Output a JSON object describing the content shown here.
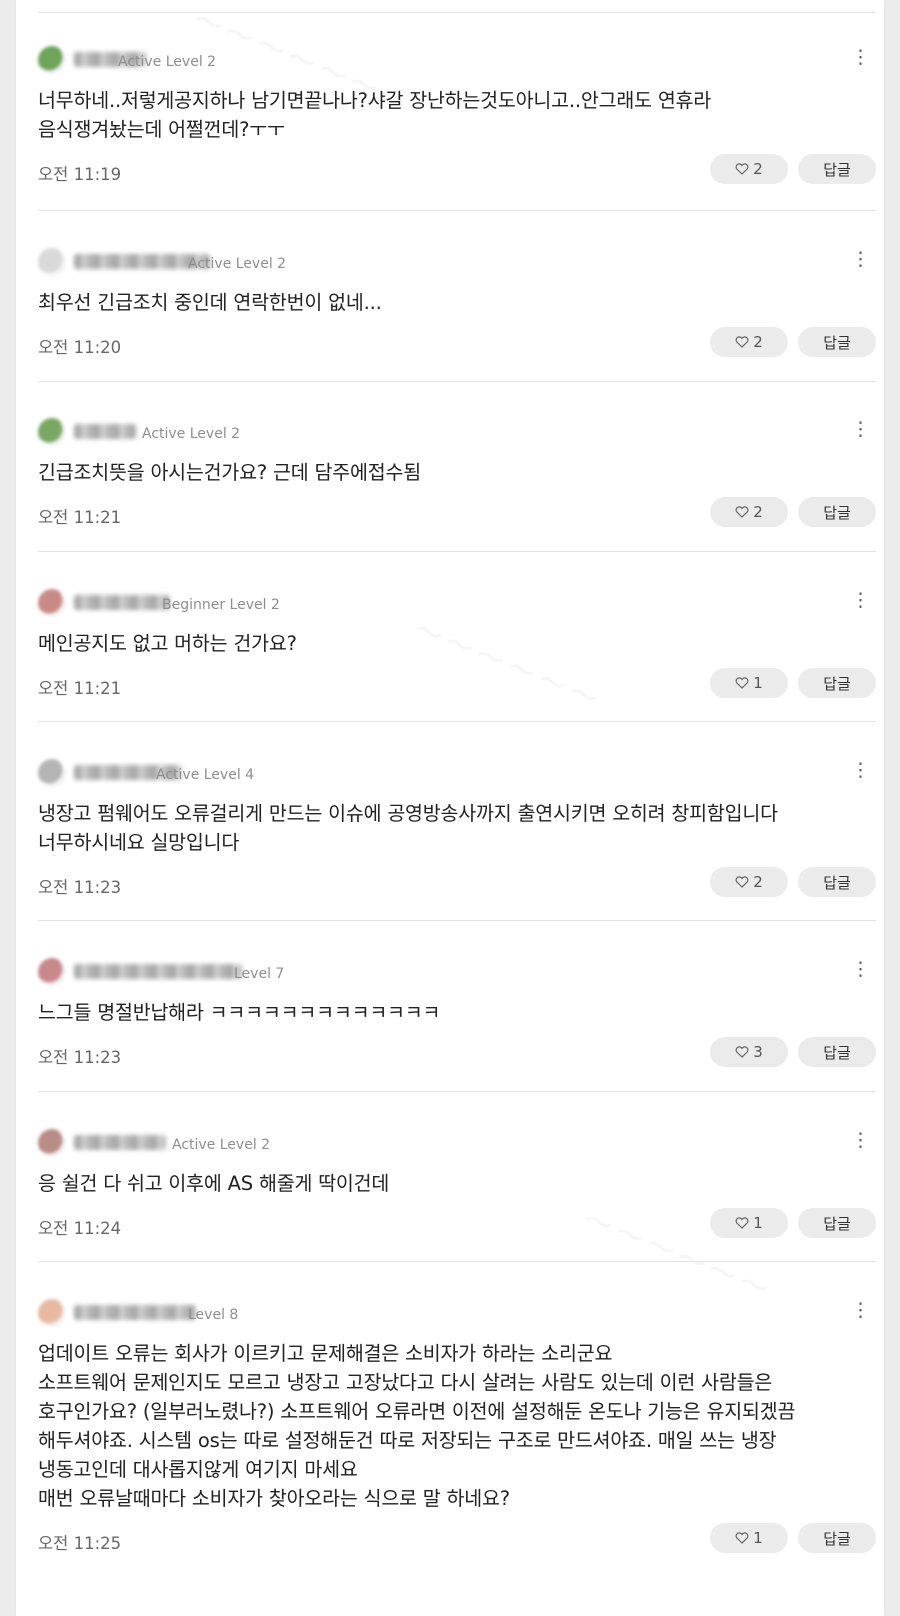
{
  "comments": [
    {
      "level": "Active Level 2",
      "text": "너무하네..저렇게공지하나 남기면끝나나?샤갈 장난하는것도아니고..안그래도 연휴라\n음식쟁겨놨는데 어쩔껀데?ㅜㅜ",
      "time": "오전 11:19",
      "likes": "2",
      "reply": "답글",
      "avatar_color": "#6ea55a"
    },
    {
      "level": "Active Level 2",
      "text": "최우선 긴급조치 중인데 연락한번이 없네...",
      "time": "오전 11:20",
      "likes": "2",
      "reply": "답글",
      "avatar_color": "#d9d9d9"
    },
    {
      "level": "Active Level 2",
      "text": "긴급조치뜻을 아시는건가요? 근데 담주에접수됨",
      "time": "오전 11:21",
      "likes": "2",
      "reply": "답글",
      "avatar_color": "#79a862"
    },
    {
      "level": "Beginner Level 2",
      "text": "메인공지도 없고 머하는 건가요?",
      "time": "오전 11:21",
      "likes": "1",
      "reply": "답글",
      "avatar_color": "#c98a86"
    },
    {
      "level": "Active Level 4",
      "text": "냉장고 펌웨어도 오류걸리게 만드는 이슈에 공영방송사까지 출연시키면 오히려 창피함입니다\n너무하시네요 실망입니다",
      "time": "오전 11:23",
      "likes": "2",
      "reply": "답글",
      "avatar_color": "#b5b5b5"
    },
    {
      "level": "Level 7",
      "text": "느그들 명절반납해라 ㅋㅋㅋㅋㅋㅋㅋㅋㅋㅋㅋㅋㅋ",
      "time": "오전 11:23",
      "likes": "3",
      "reply": "답글",
      "avatar_color": "#c9898c"
    },
    {
      "level": "Active Level 2",
      "text": "응 쉴건 다 쉬고 이후에 AS 해줄게 딱이건데",
      "time": "오전 11:24",
      "likes": "1",
      "reply": "답글",
      "avatar_color": "#b98c86"
    },
    {
      "level": "Level 8",
      "text": "업데이트 오류는 회사가 이르키고 문제해결은 소비자가 하라는 소리군요\n소프트웨어 문제인지도 모르고 냉장고 고장났다고 다시 살려는 사람도 있는데 이런 사람들은\n호구인가요? (일부러노렸나?) 소프트웨어 오류라면 이전에 설정해둔 온도나 기능은 유지되겠끔\n해두셔야죠. 시스템 os는 따로 설정해둔건 따로 저장되는 구조로 만드셔야죠. 매일 쓰는 냉장\n냉동고인데 대사롭지않게 여기지 마세요\n매번 오류날때마다 소비자가 찾아오라는 식으로 말 하네요?",
      "time": "오전 11:25",
      "likes": "1",
      "reply": "답글",
      "avatar_color": "#e8b9a0"
    }
  ]
}
